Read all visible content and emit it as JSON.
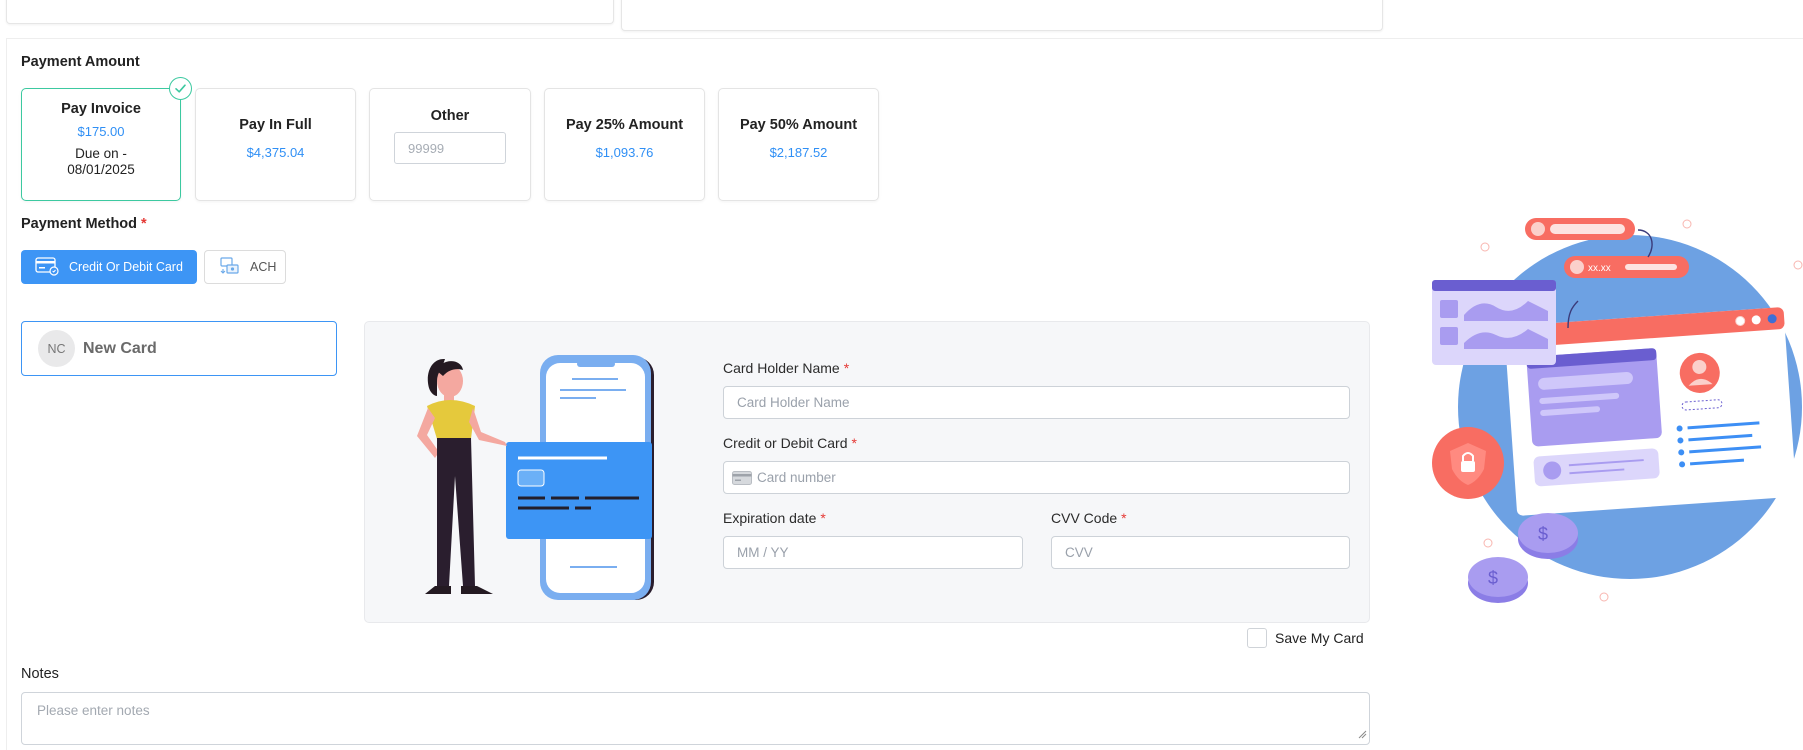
{
  "payment_amount": {
    "label": "Payment Amount",
    "options": [
      {
        "title": "Pay Invoice",
        "value": "$175.00",
        "due": "Due on - 08/01/2025",
        "selected": true
      },
      {
        "title": "Pay In Full",
        "value": "$4,375.04"
      },
      {
        "title": "Other",
        "placeholder": "99999"
      },
      {
        "title": "Pay 25% Amount",
        "value": "$1,093.76"
      },
      {
        "title": "Pay 50% Amount",
        "value": "$2,187.52"
      }
    ]
  },
  "payment_method": {
    "label": "Payment Method",
    "required_mark": "*",
    "methods": [
      {
        "label": "Credit Or Debit Card",
        "icon": "credit-card-icon",
        "active": true
      },
      {
        "label": "ACH",
        "icon": "bank-transfer-icon",
        "active": false
      }
    ]
  },
  "saved_card": {
    "initials": "NC",
    "label": "New Card"
  },
  "card_form": {
    "holder_name": {
      "label": "Card Holder Name",
      "required_mark": "*",
      "placeholder": "Card Holder Name"
    },
    "card_number": {
      "label": "Credit or Debit Card",
      "required_mark": "*",
      "placeholder": "Card number"
    },
    "expiration": {
      "label": "Expiration date",
      "required_mark": "*",
      "placeholder": "MM / YY"
    },
    "cvv": {
      "label": "CVV Code",
      "required_mark": "*",
      "placeholder": "CVV"
    }
  },
  "save_card": {
    "label": "Save My Card",
    "checked": false
  },
  "notes": {
    "label": "Notes",
    "placeholder": "Please enter notes"
  },
  "illustration_text": {
    "masked_amount": "xx.xx"
  },
  "colors": {
    "accent": "#3d95f5",
    "success": "#3cc9a0",
    "required": "#e53935",
    "value_blue": "#2f8ff5",
    "coral": "#f86d62",
    "lavender": "#a99cf0"
  }
}
